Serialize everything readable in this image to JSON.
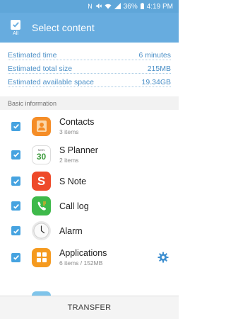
{
  "status_bar": {
    "battery": "36%",
    "time": "4:19 PM"
  },
  "app_bar": {
    "select_all_label": "All",
    "title": "Select content"
  },
  "summary": {
    "rows": [
      {
        "label": "Estimated time",
        "value": "6 minutes"
      },
      {
        "label": "Estimated total size",
        "value": "215MB"
      },
      {
        "label": "Estimated available space",
        "value": "19.34GB"
      }
    ]
  },
  "section": {
    "title": "Basic information"
  },
  "items": [
    {
      "label": "Contacts",
      "sub": "3 items",
      "checked": true,
      "icon": "contacts-icon"
    },
    {
      "label": "S Planner",
      "sub": "2 items",
      "checked": true,
      "icon": "calendar-icon",
      "icon_text": "30",
      "icon_header": "MON"
    },
    {
      "label": "S Note",
      "sub": "",
      "checked": true,
      "icon": "s-note-icon",
      "icon_text": "S"
    },
    {
      "label": "Call log",
      "sub": "",
      "checked": true,
      "icon": "call-log-icon"
    },
    {
      "label": "Alarm",
      "sub": "",
      "checked": true,
      "icon": "clock-icon"
    },
    {
      "label": "Applications",
      "sub": "6 items / 152MB",
      "checked": true,
      "icon": "apps-icon",
      "has_settings": true
    }
  ],
  "bottom": {
    "transfer_label": "TRANSFER"
  },
  "colors": {
    "app_bar": "#67acdf",
    "status_bar": "#5fa6d9",
    "accent_text": "#4a8fc7",
    "checkbox": "#46a3e0"
  }
}
